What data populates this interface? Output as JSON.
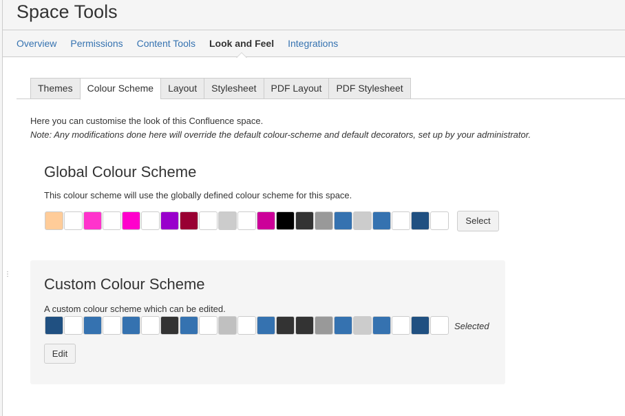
{
  "header": {
    "title": "Space Tools"
  },
  "topnav": {
    "items": [
      {
        "label": "Overview"
      },
      {
        "label": "Permissions"
      },
      {
        "label": "Content Tools"
      },
      {
        "label": "Look and Feel"
      },
      {
        "label": "Integrations"
      }
    ],
    "active": "Look and Feel"
  },
  "subtabs": {
    "items": [
      {
        "label": "Themes"
      },
      {
        "label": "Colour Scheme"
      },
      {
        "label": "Layout"
      },
      {
        "label": "Stylesheet"
      },
      {
        "label": "PDF Layout"
      },
      {
        "label": "PDF Stylesheet"
      }
    ],
    "active": "Colour Scheme"
  },
  "intro": {
    "text": "Here you can customise the look of this Confluence space.",
    "note": "Note: Any modifications done here will override the default colour-scheme and default decorators, set up by your administrator."
  },
  "global_scheme": {
    "title": "Global Colour Scheme",
    "description": "This colour scheme will use the globally defined colour scheme for this space.",
    "colors": [
      "#ffcc99",
      "#ffffff",
      "#ff33cc",
      "#ffffff",
      "#ff00cc",
      "#ffffff",
      "#9900cc",
      "#990033",
      "#ffffff",
      "#cccccc",
      "#ffffff",
      "#cc0099",
      "#000000",
      "#333333",
      "#999999",
      "#3572b0",
      "#cccccc",
      "#3572b0",
      "#ffffff",
      "#205081",
      "#ffffff"
    ],
    "button_label": "Select"
  },
  "custom_scheme": {
    "title": "Custom Colour Scheme",
    "description": "A custom colour scheme which can be edited.",
    "colors": [
      "#205081",
      "#ffffff",
      "#3572b0",
      "#ffffff",
      "#3572b0",
      "#ffffff",
      "#333333",
      "#3572b0",
      "#ffffff",
      "#c0c0c0",
      "#ffffff",
      "#3572b0",
      "#333333",
      "#333333",
      "#999999",
      "#3572b0",
      "#cccccc",
      "#3572b0",
      "#ffffff",
      "#205081",
      "#ffffff"
    ],
    "status_label": "Selected",
    "button_label": "Edit"
  }
}
